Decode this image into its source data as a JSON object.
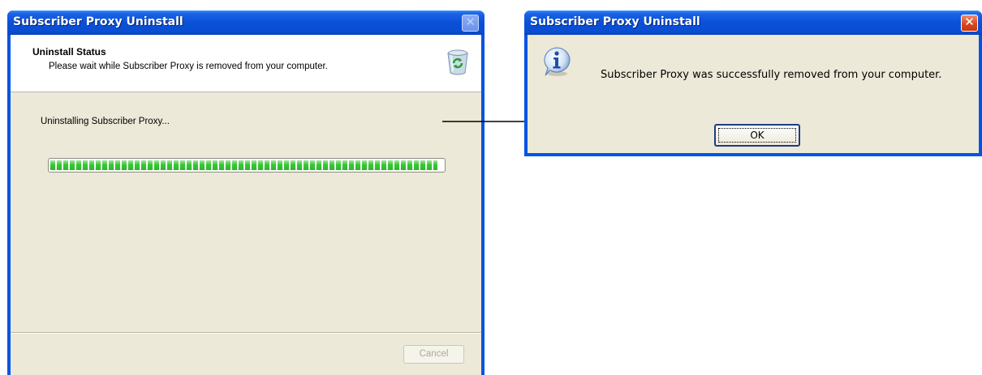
{
  "left_window": {
    "title": "Subscriber Proxy Uninstall",
    "header": {
      "title": "Uninstall Status",
      "subtitle": "Please wait while Subscriber Proxy is removed from your computer."
    },
    "status_text": "Uninstalling Subscriber Proxy...",
    "progress_fraction": 0.985,
    "buttons": {
      "cancel": "Cancel"
    },
    "icons": {
      "header": "recycle-bin-icon",
      "close": "close-icon"
    }
  },
  "right_window": {
    "title": "Subscriber Proxy Uninstall",
    "message": "Subscriber Proxy was successfully removed from your computer.",
    "buttons": {
      "ok": "OK"
    },
    "icons": {
      "message": "info-icon",
      "close": "close-icon"
    }
  },
  "colors": {
    "titlebar": "#0a50d8",
    "progress": "#37c832",
    "close_button": "#d8451d",
    "dialog_bg": "#ece9d8"
  }
}
